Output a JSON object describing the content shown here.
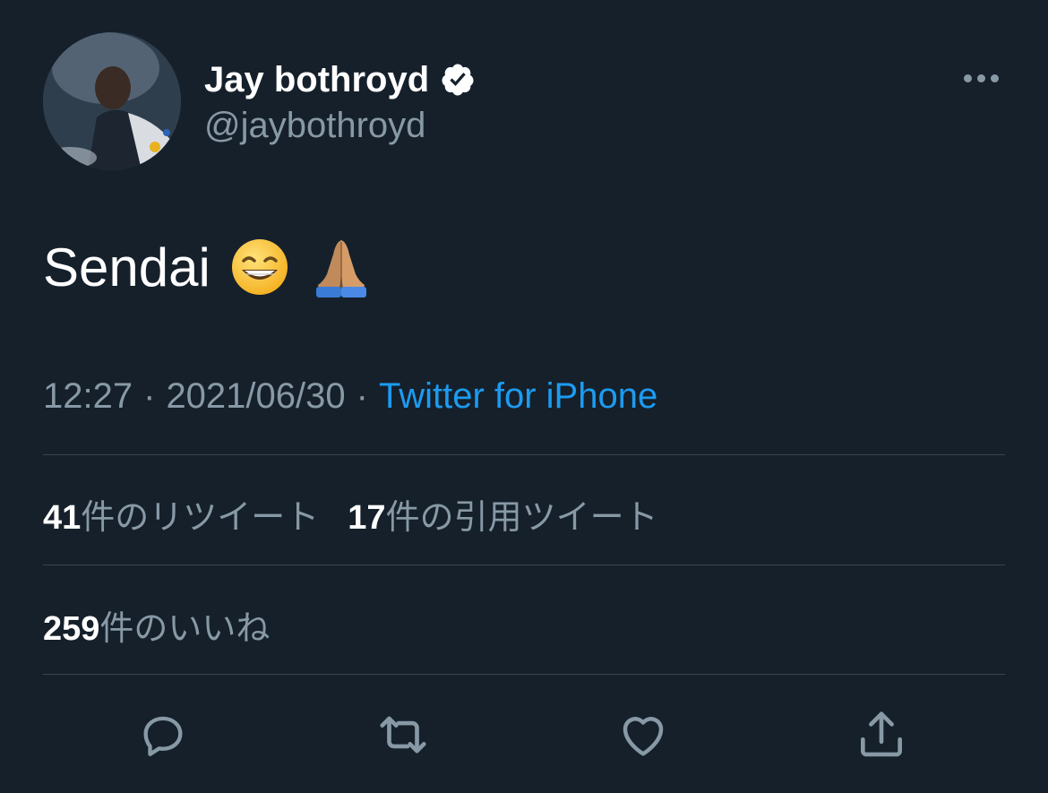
{
  "author": {
    "display_name": "Jay bothroyd",
    "handle": "@jaybothroyd",
    "verified": true
  },
  "tweet": {
    "text": "Sendai",
    "emojis": [
      "grinning-face-with-smiling-eyes",
      "folded-hands-medium-skin-tone"
    ]
  },
  "meta": {
    "time": "12:27",
    "separator": "·",
    "date": "2021/06/30",
    "source": "Twitter for iPhone"
  },
  "stats": {
    "retweets": {
      "count": "41",
      "label": "件のリツイート"
    },
    "quote_tweets": {
      "count": "17",
      "label": "件の引用ツイート"
    },
    "likes": {
      "count": "259",
      "label": "件のいいね"
    }
  },
  "actions": [
    "reply-icon",
    "retweet-icon",
    "like-icon",
    "share-icon"
  ],
  "colors": {
    "background": "#15202b",
    "primary_text": "#ffffff",
    "secondary_text": "#8899a6",
    "accent": "#1d9bf0",
    "divider": "#38444d"
  }
}
